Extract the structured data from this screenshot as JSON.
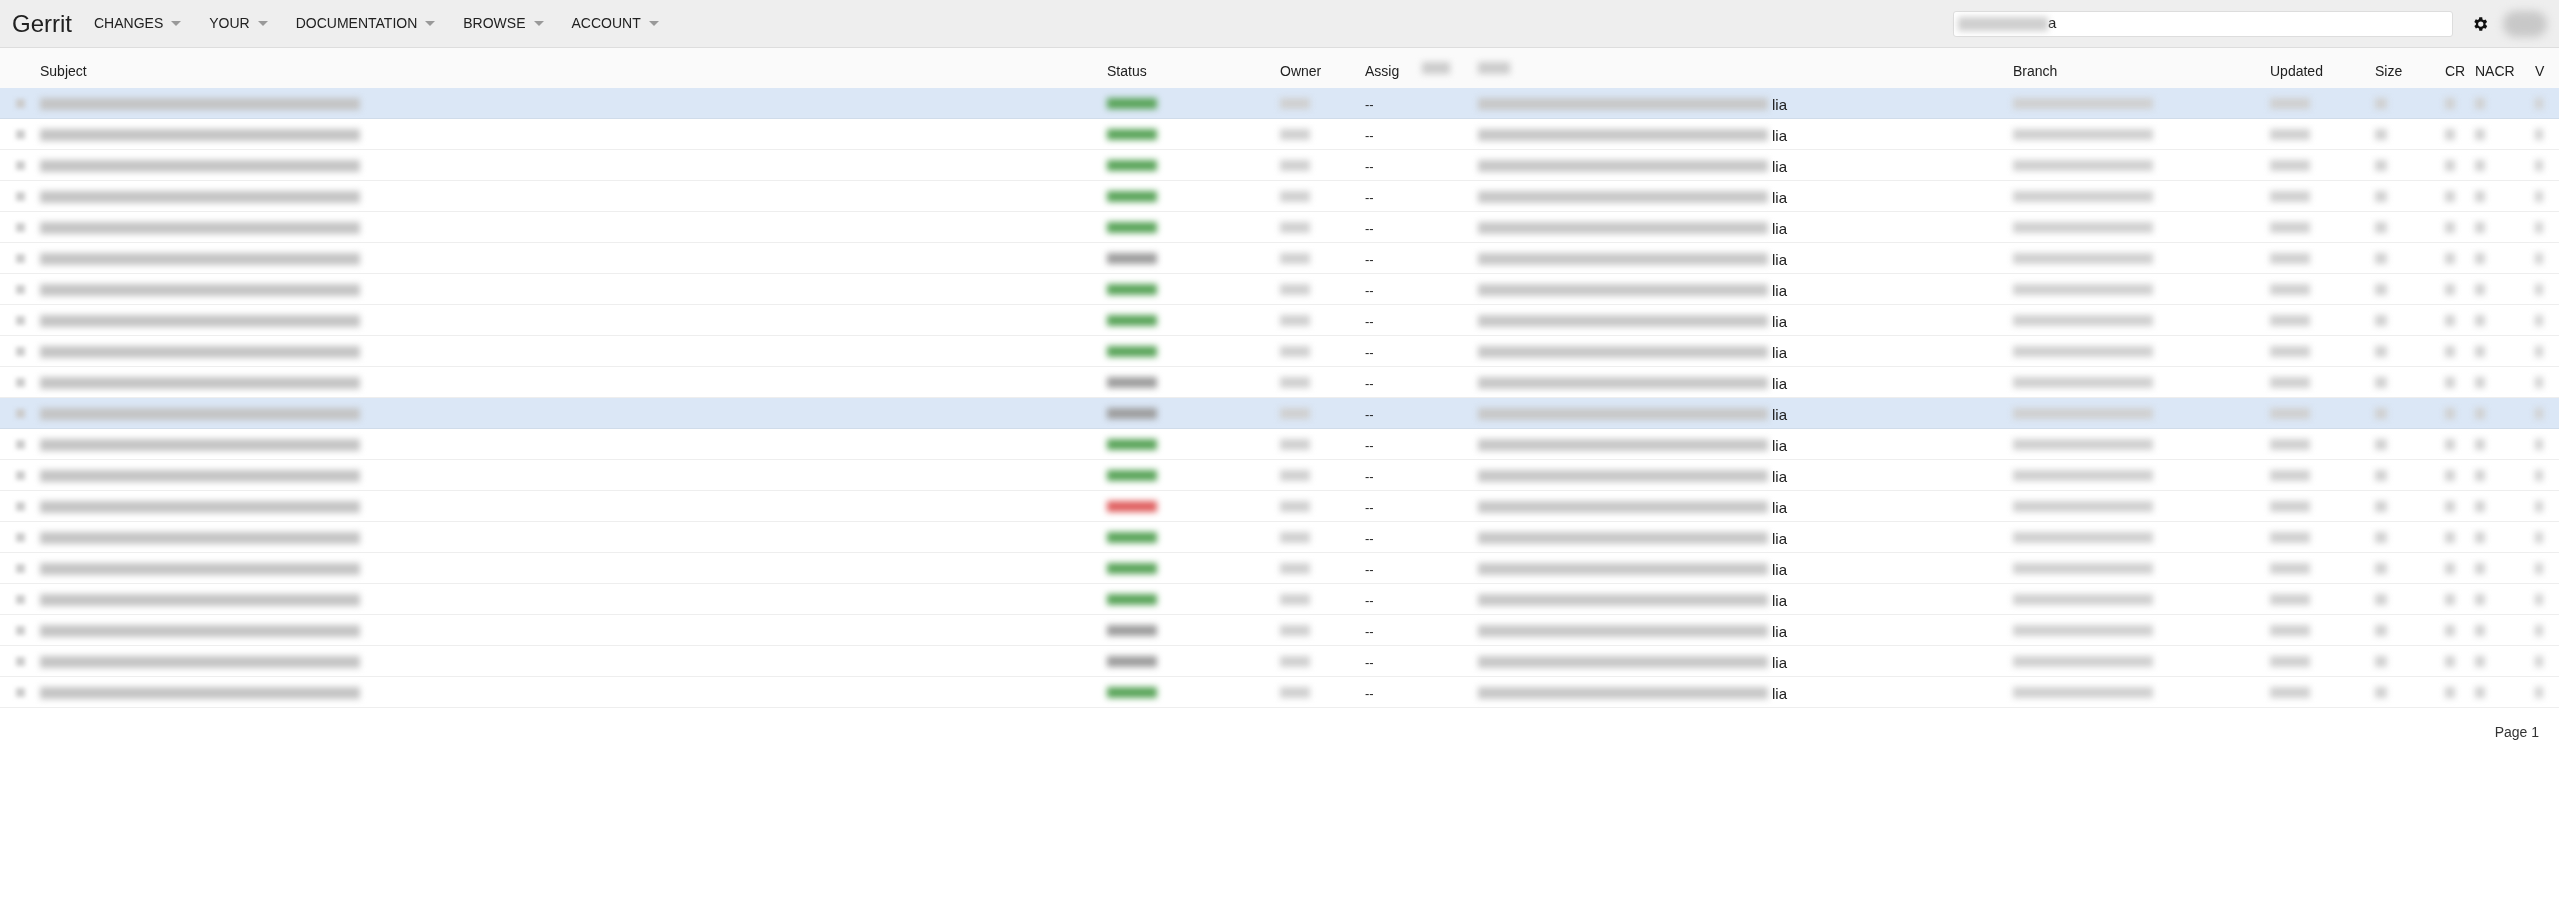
{
  "header": {
    "logo": "Gerrit",
    "menus": [
      {
        "label": "CHANGES"
      },
      {
        "label": "YOUR"
      },
      {
        "label": "DOCUMENTATION"
      },
      {
        "label": "BROWSE"
      },
      {
        "label": "ACCOUNT"
      }
    ],
    "search": {
      "value": "a"
    }
  },
  "table": {
    "columns": [
      "Subject",
      "Status",
      "Owner",
      "Assig",
      "Branch",
      "Updated",
      "Size",
      "CR",
      "NACR",
      "V"
    ],
    "rows": [
      {
        "selected": true,
        "color": "#5aa55a",
        "assignee": "--",
        "repo_tail": "lia"
      },
      {
        "selected": false,
        "color": "#5aa55a",
        "assignee": "--",
        "repo_tail": "lia"
      },
      {
        "selected": false,
        "color": "#5aa55a",
        "assignee": "--",
        "repo_tail": "lia"
      },
      {
        "selected": false,
        "color": "#5aa55a",
        "assignee": "--",
        "repo_tail": "lia"
      },
      {
        "selected": false,
        "color": "#5aa55a",
        "assignee": "--",
        "repo_tail": "lia"
      },
      {
        "selected": false,
        "color": "#9e9e9e",
        "assignee": "--",
        "repo_tail": "lia"
      },
      {
        "selected": false,
        "color": "#5aa55a",
        "assignee": "--",
        "repo_tail": "lia"
      },
      {
        "selected": false,
        "color": "#5aa55a",
        "assignee": "--",
        "repo_tail": "lia"
      },
      {
        "selected": false,
        "color": "#5aa55a",
        "assignee": "--",
        "repo_tail": "lia"
      },
      {
        "selected": false,
        "color": "#9e9e9e",
        "assignee": "--",
        "repo_tail": "lia"
      },
      {
        "selected": true,
        "color": "#9e9e9e",
        "assignee": "--",
        "repo_tail": "lia"
      },
      {
        "selected": false,
        "color": "#5aa55a",
        "assignee": "--",
        "repo_tail": "lia"
      },
      {
        "selected": false,
        "color": "#5aa55a",
        "assignee": "--",
        "repo_tail": "lia"
      },
      {
        "selected": false,
        "color": "#e06060",
        "assignee": "--",
        "repo_tail": "lia"
      },
      {
        "selected": false,
        "color": "#5aa55a",
        "assignee": "--",
        "repo_tail": "lia"
      },
      {
        "selected": false,
        "color": "#5aa55a",
        "assignee": "--",
        "repo_tail": "lia"
      },
      {
        "selected": false,
        "color": "#5aa55a",
        "assignee": "--",
        "repo_tail": "lia"
      },
      {
        "selected": false,
        "color": "#9e9e9e",
        "assignee": "--",
        "repo_tail": "lia"
      },
      {
        "selected": false,
        "color": "#9e9e9e",
        "assignee": "--",
        "repo_tail": "lia"
      },
      {
        "selected": false,
        "color": "#5aa55a",
        "assignee": "--",
        "repo_tail": "lia"
      }
    ]
  },
  "footer": {
    "page": "Page 1"
  }
}
